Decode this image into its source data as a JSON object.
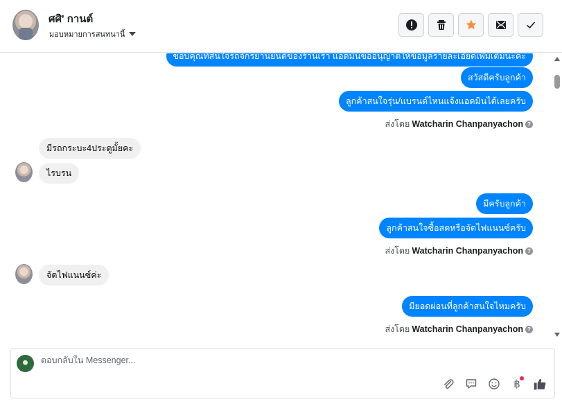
{
  "header": {
    "contact_name": "ศศิ' กานต์",
    "assign_label": "มอบหมายการสนทนานี้",
    "actions": [
      {
        "name": "report-spam",
        "icon": "exclamation-circle-icon"
      },
      {
        "name": "delete",
        "icon": "trash-icon"
      },
      {
        "name": "star",
        "icon": "star-icon",
        "color": "#f7923b"
      },
      {
        "name": "mark-unread",
        "icon": "envelope-icon"
      },
      {
        "name": "mark-done",
        "icon": "check-icon"
      }
    ]
  },
  "thread": {
    "messages": [
      {
        "dir": "out",
        "text": "ขอบคุณที่สนใจรถจักรยานยนต์ของร้านเรา แอดมินขออนุญาตให้ข้อมูลรายละเอียดเพิ่มเติมนะคะ"
      },
      {
        "dir": "out",
        "text": "สวัสดีครับลูกค้า"
      },
      {
        "dir": "out",
        "text": "ลูกค้าสนใจรุ่น/แบรนด์ไหนแจ้งแอดมินได้เลยครับ"
      },
      {
        "dir": "meta",
        "prefix": "ส่งโดย",
        "sender": "Watcharin Chanpanyachon"
      },
      {
        "dir": "in",
        "text": "มีรถกระบะ4ประตูมั้ยคะ"
      },
      {
        "dir": "in",
        "text": "ไรบรน"
      },
      {
        "dir": "out",
        "text": "มีครับลูกค้า"
      },
      {
        "dir": "out",
        "text": "ลูกค้าสนใจซื้อสดหรือจัดไฟแนนซ์ครับ"
      },
      {
        "dir": "meta",
        "prefix": "ส่งโดย",
        "sender": "Watcharin Chanpanyachon"
      },
      {
        "dir": "in",
        "text": "จัดไฟแนนซ์ค่ะ"
      },
      {
        "dir": "out",
        "text": "มียอดผ่อนที่ลูกค้าสนใจไหมครับ"
      },
      {
        "dir": "meta",
        "prefix": "ส่งโดย",
        "sender": "Watcharin Chanpanyachon"
      }
    ]
  },
  "composer": {
    "placeholder": "ตอบกลับใน Messenger...",
    "icons": [
      "paperclip-icon",
      "saved-reply-icon",
      "emoji-icon",
      "baht-payment-icon",
      "like-icon"
    ],
    "baht_symbol": "฿"
  },
  "colors": {
    "outgoing_bubble": "#0084ff",
    "incoming_bubble": "#f0f0f0",
    "notification_dot": "#f02849"
  }
}
